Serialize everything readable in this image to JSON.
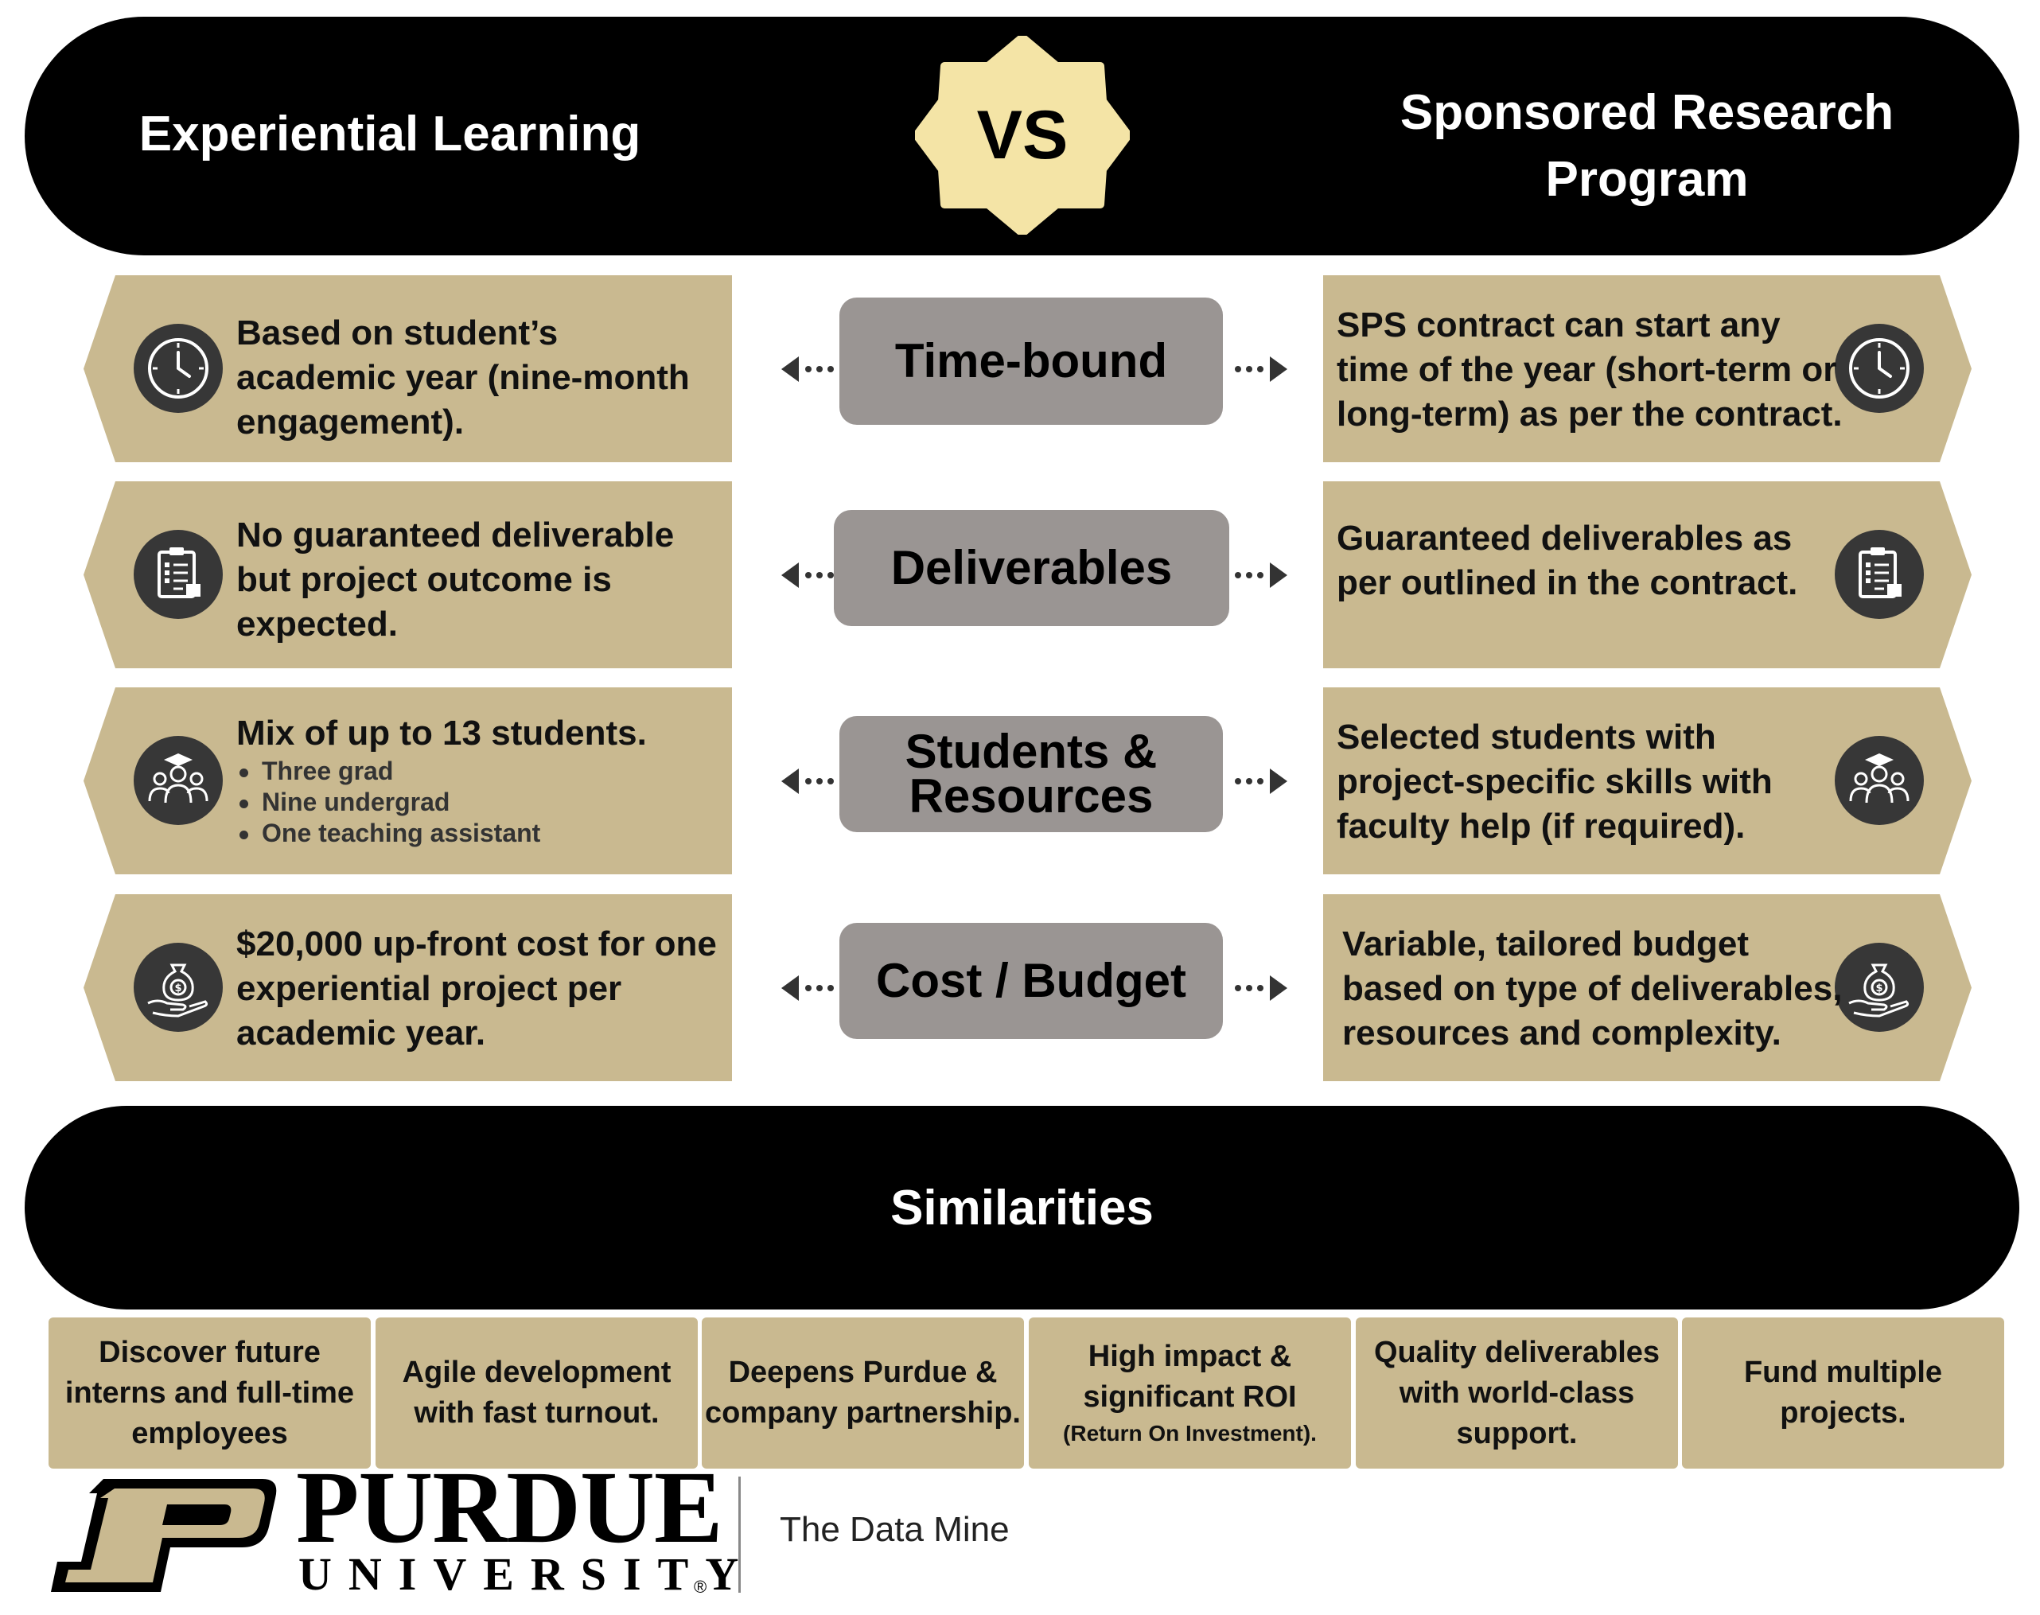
{
  "header": {
    "left_title": "Experiential Learning",
    "vs": "VS",
    "right_title": "Sponsored Research Program"
  },
  "rows": [
    {
      "category": "Time-bound",
      "icon": "clock-icon",
      "left": "Based on student’s academic year (nine-month engagement).",
      "right": "SPS contract can start any time of the year (short-term or long-term) as per the contract."
    },
    {
      "category": "Deliverables",
      "icon": "clipboard-checklist-icon",
      "left": "No guaranteed deliverable but project outcome is expected.",
      "right": "Guaranteed deliverables as per outlined in the contract."
    },
    {
      "category": "Students & Resources",
      "icon": "students-group-icon",
      "left": "Mix of up to 13 students.",
      "left_bullets": [
        "Three grad",
        "Nine undergrad",
        "One teaching assistant"
      ],
      "right": "Selected students with project-specific skills with faculty help (if required)."
    },
    {
      "category": "Cost / Budget",
      "icon": "money-bag-hand-icon",
      "left": "$20,000 up-front cost for one experiential project per academic year.",
      "right": "Variable, tailored budget based on type of deliverables, resources and complexity."
    }
  ],
  "similarities": {
    "title": "Similarities",
    "items": [
      {
        "text": "Discover future interns and full-time employees",
        "sub": ""
      },
      {
        "text": "Agile development with fast turnout.",
        "sub": ""
      },
      {
        "text": "Deepens Purdue & company partnership.",
        "sub": ""
      },
      {
        "text": "High impact & significant ROI",
        "sub": "(Return On Investment)."
      },
      {
        "text": "Quality deliverables with world-class support.",
        "sub": ""
      },
      {
        "text": "Fund multiple projects.",
        "sub": ""
      }
    ]
  },
  "footer": {
    "university_name": "PURDUE",
    "university_sub": "UNIVERSITY",
    "registered": "®",
    "department": "The Data Mine"
  },
  "colors": {
    "gold": "#c9b990",
    "gray_box": "#9a9593",
    "vs_badge": "#f4e4a6",
    "black": "#000000",
    "icon_bg": "#373737"
  }
}
